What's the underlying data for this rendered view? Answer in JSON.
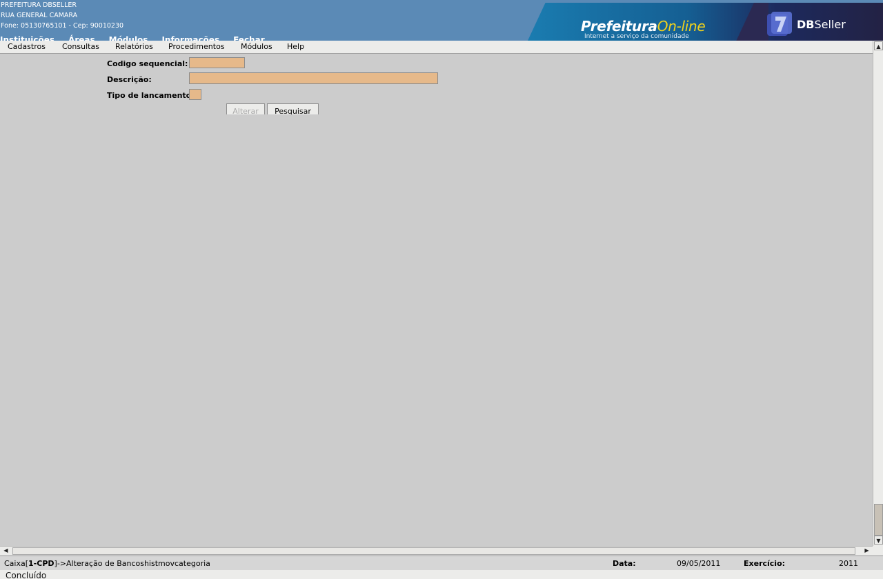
{
  "header": {
    "org_name": "PREFEITURA DBSELLER",
    "address": "RUA GENERAL CAMARA",
    "contact": "Fone: 05130765101  - Cep: 90010230",
    "top_nav": [
      "Instituições",
      "Áreas",
      "Módulos",
      "Informações",
      "Fechar"
    ]
  },
  "banner": {
    "title_main": "Prefeitura",
    "title_accent": "On-line",
    "tagline": "Internet a serviço da comunidade",
    "logo_text_bold": "DB",
    "logo_text": "Seller"
  },
  "menubar": [
    "Cadastros",
    "Consultas",
    "Relatórios",
    "Procedimentos",
    "Módulos",
    "Help"
  ],
  "form": {
    "codigo_label": "Codigo sequencial:",
    "codigo_value": "",
    "descricao_label": "Descrição:",
    "descricao_value": "",
    "tipo_label": "Tipo de lancamento:",
    "tipo_value": "",
    "alterar_button": "Alterar",
    "pesquisar_button": "Pesquisar"
  },
  "status": {
    "path_prefix": "Caixa[",
    "path_bold": "1-CPD",
    "path_suffix": "]->Alteração de Bancoshistmovcategoria",
    "data_label": "Data:",
    "data_value": "09/05/2011",
    "exercicio_label": "Exercício:",
    "exercicio_value": "2011",
    "browser_status": "Concluído"
  },
  "colors": {
    "header_bg": "#5b8ab6",
    "field_bg": "#e6b98a",
    "page_bg": "#cccccc"
  }
}
